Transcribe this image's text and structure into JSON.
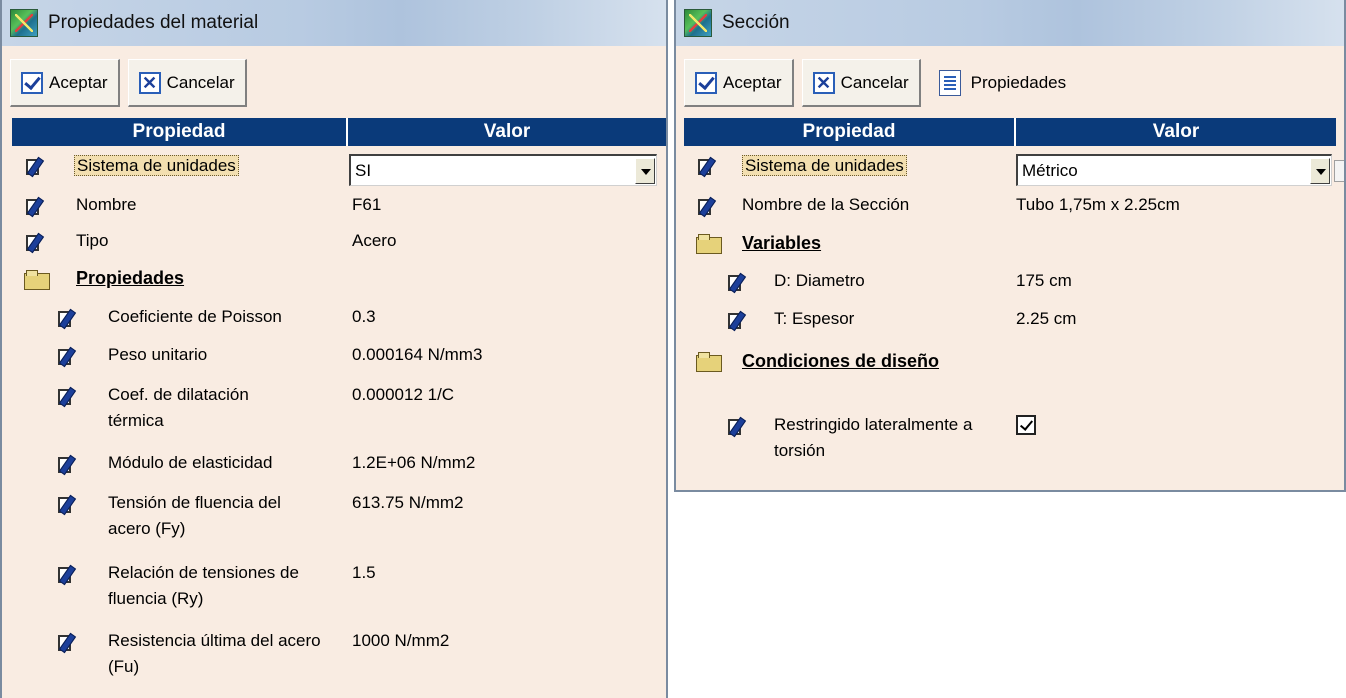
{
  "material": {
    "title": "Propiedades del material",
    "toolbar": {
      "accept": "Aceptar",
      "cancel": "Cancelar"
    },
    "header": {
      "prop": "Propiedad",
      "val": "Valor"
    },
    "units": {
      "label": "Sistema de unidades",
      "value": "SI"
    },
    "nombre": {
      "label": "Nombre",
      "value": "F61"
    },
    "tipo": {
      "label": "Tipo",
      "value": "Acero"
    },
    "group": "Propiedades",
    "props": [
      {
        "label": "Coeficiente de Poisson",
        "value": "0.3"
      },
      {
        "label": "Peso unitario",
        "value": "0.000164  N/mm3"
      },
      {
        "label": "Coef. de dilatación térmica",
        "value": "0.000012  1/C"
      },
      {
        "label": "Módulo de elasticidad",
        "value": "1.2E+06  N/mm2"
      },
      {
        "label": "Tensión de fluencia del acero (Fy)",
        "value": "613.75  N/mm2"
      },
      {
        "label": "Relación de tensiones de fluencia (Ry)",
        "value": "1.5"
      },
      {
        "label": "Resistencia última del acero (Fu)",
        "value": "1000  N/mm2"
      }
    ]
  },
  "seccion": {
    "title": "Sección",
    "toolbar": {
      "accept": "Aceptar",
      "cancel": "Cancelar",
      "props": "Propiedades"
    },
    "header": {
      "prop": "Propiedad",
      "val": "Valor"
    },
    "units": {
      "label": "Sistema de unidades",
      "value": "Métrico"
    },
    "nombre": {
      "label": "Nombre de la Sección",
      "value": "Tubo 1,75m x 2.25cm"
    },
    "group1": "Variables",
    "vars": [
      {
        "label": "D:  Diametro",
        "value": "175  cm"
      },
      {
        "label": "T:  Espesor",
        "value": "2.25  cm"
      }
    ],
    "group2": "Condiciones de diseño",
    "restr": {
      "label": "Restringido lateralmente a torsión",
      "checked": true
    }
  }
}
